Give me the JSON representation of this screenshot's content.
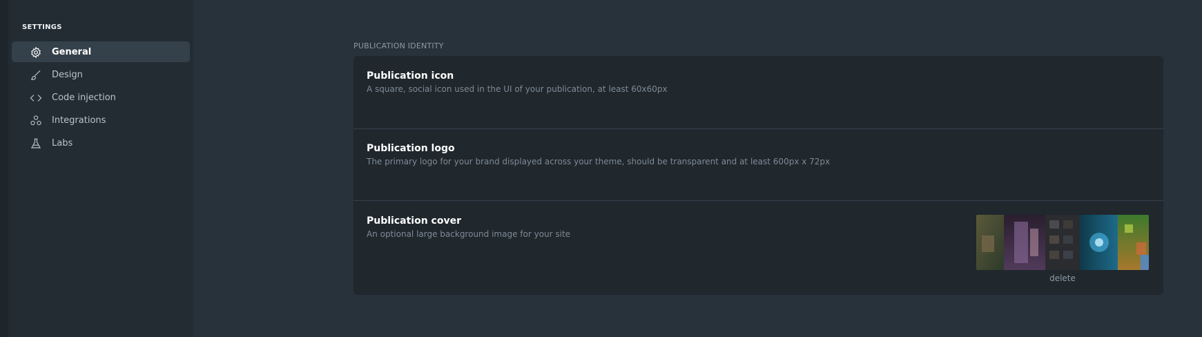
{
  "sidebar": {
    "heading": "SETTINGS",
    "items": [
      {
        "label": "General",
        "icon": "gear-icon",
        "active": true
      },
      {
        "label": "Design",
        "icon": "brush-icon"
      },
      {
        "label": "Code injection",
        "icon": "code-icon"
      },
      {
        "label": "Integrations",
        "icon": "integrations-icon"
      },
      {
        "label": "Labs",
        "icon": "flask-icon"
      }
    ]
  },
  "main": {
    "section_title": "PUBLICATION IDENTITY",
    "rows": [
      {
        "title": "Publication icon",
        "description": "A square, social icon used in the UI of your publication, at least 60x60px"
      },
      {
        "title": "Publication logo",
        "description": "The primary logo for your brand displayed across your theme, should be transparent and at least 600px x 72px"
      },
      {
        "title": "Publication cover",
        "description": "An optional large background image for your site",
        "delete_label": "delete"
      }
    ]
  },
  "colors": {
    "background": "#28323a",
    "sidebar": "#232c33",
    "card": "#20272d",
    "active_item": "#35414a"
  }
}
